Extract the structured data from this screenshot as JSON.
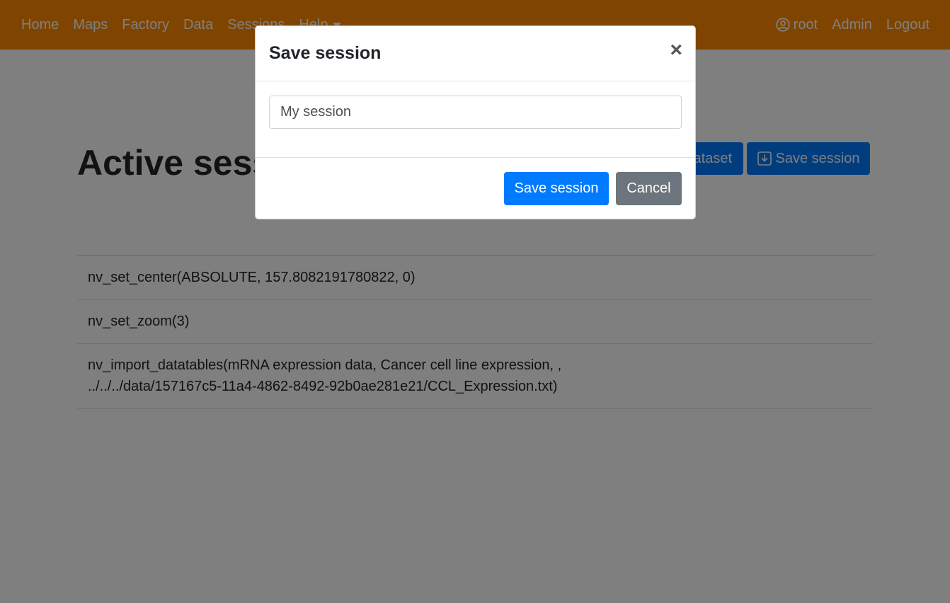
{
  "navbar": {
    "left_items": [
      "Home",
      "Maps",
      "Factory",
      "Data",
      "Sessions"
    ],
    "help_label": "Help",
    "user_label": "root",
    "admin_label": "Admin",
    "logout_label": "Logout"
  },
  "page": {
    "title": "Active session",
    "dataset_button_label": "Import dataset",
    "save_button_label": "Save session",
    "history": [
      "nv_set_center(ABSOLUTE, 157.8082191780822, 0)",
      "nv_set_zoom(3)",
      "nv_import_datatables(mRNA expression data, Cancer cell line expression, , ../../../data/157167c5-11a4-4862-8492-92b0ae281e21/CCL_Expression.txt)"
    ]
  },
  "modal": {
    "title": "Save session",
    "close_symbol": "×",
    "input_value": "My session",
    "save_label": "Save session",
    "cancel_label": "Cancel"
  },
  "colors": {
    "navbar": "#ff8a00",
    "primary": "#007bff",
    "secondary": "#6c757d"
  },
  "icons": {
    "user": "user-circle-icon",
    "caret": "caret-down-icon",
    "save": "download-icon",
    "close": "close-icon"
  }
}
